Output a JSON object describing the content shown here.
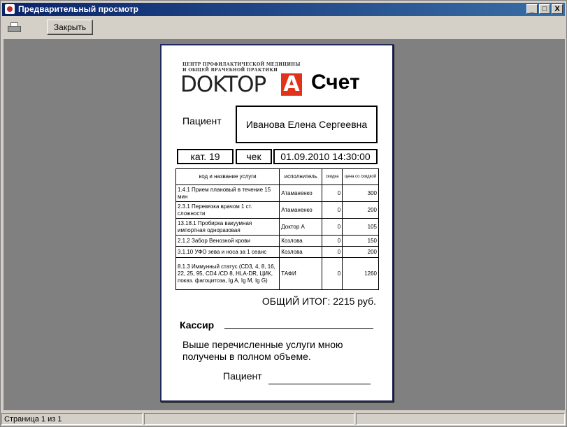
{
  "window": {
    "title": "Предварительный просмотр",
    "controls": {
      "minimize": "_",
      "maximize": "□",
      "close": "X"
    }
  },
  "toolbar": {
    "print_icon": "printer-icon",
    "close_label": "Закрыть"
  },
  "document": {
    "center_line1": "ЦЕНТР ПРОФИЛАКТИЧЕСКОЙ МЕДИЦИНЫ",
    "center_line2": "И ОБЩЕЙ ВРАЧЕБНОЙ ПРАКТИКИ",
    "logo_word": "DOKTOP",
    "logo_letter": "A",
    "heading": "Счет",
    "patient_label": "Пациент",
    "patient_name": "Иванова Елена Сергеевна",
    "category": "кат. 19",
    "check": "чек",
    "datetime": "01.09.2010 14:30:00",
    "table": {
      "headers": [
        "код и название услуги",
        "исполнитель",
        "скидка",
        "цена со скидкой"
      ],
      "rows": [
        {
          "service": "1.4.1  Прием  плановый в течение 15 мин",
          "performer": "Атаманенко",
          "discount": "0",
          "price": "300"
        },
        {
          "service": "2.3.1  Перевязка врачом  1 ст. сложности",
          "performer": "Атаманенко",
          "discount": "0",
          "price": "200"
        },
        {
          "service": "13.18.1 Пробирка вакуумная импортная одноразовая",
          "performer": "Доктор А",
          "discount": "0",
          "price": "105"
        },
        {
          "service": "2.1.2  Забор Венозной крови",
          "performer": "Козлова",
          "discount": "0",
          "price": "150"
        },
        {
          "service": "3.1.10  УФО зева и носа за 1 сеанс",
          "performer": "Козлова",
          "discount": "0",
          "price": "200"
        },
        {
          "service": "8.1.3  Иммунный статус  (CD3, 4, 8, 16, 22,  25, 95, CD4 /CD 8, HLA-DR,  ЦИК, показ. фагоцитоза, Ig A, Ig M, Ig G)",
          "performer": "ТАФИ",
          "discount": "0",
          "price": "1260"
        }
      ]
    },
    "total": "ОБЩИЙ ИТОГ: 2215 руб.",
    "cashier_label": "Кассир",
    "acknowledgement": "Выше перечисленные услуги мною получены в полном объеме.",
    "patient_sign_label": "Пациент"
  },
  "status": {
    "page": "Страница 1 из 1"
  },
  "colors": {
    "title_bar": "#0a246a",
    "viewport_bg": "#808080",
    "logo_accent": "#e0331a",
    "page_border": "#1f2a5a"
  }
}
